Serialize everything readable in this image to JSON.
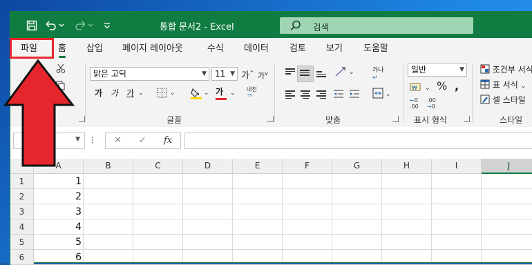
{
  "window": {
    "title": "통합 문서2  -  Excel",
    "search_placeholder": "검색",
    "quick_access": [
      "save-icon",
      "undo-icon",
      "redo-icon",
      "customize-icon"
    ]
  },
  "tabs": [
    "파일",
    "홈",
    "삽입",
    "페이지 레이아웃",
    "수식",
    "데이터",
    "검토",
    "보기",
    "도움말"
  ],
  "active_tab": "홈",
  "highlighted_tab": "파일",
  "ribbon": {
    "font": {
      "name": "맑은 고딕",
      "size": "11",
      "grow_label": "가",
      "shrink_label": "가",
      "bold": "가",
      "italic": "가",
      "underline": "가",
      "fill_color_label": "",
      "font_color_label": "가",
      "phonetic_label": "내천",
      "group_label": "글꼴"
    },
    "alignment": {
      "wrap_label": "가나",
      "group_label": "맞춤"
    },
    "number": {
      "format": "일반",
      "percent": "%",
      "group_label": "표시 형식"
    },
    "styles": {
      "items": [
        "조건부 서식",
        "표 서식",
        "셀 스타일"
      ],
      "group_label": "스타일"
    },
    "accent_color": "#107c41",
    "fill_underline_color": "#ffd400",
    "font_underline_color": "#e5262c"
  },
  "formula_bar": {
    "name_box": "",
    "cancel": "✕",
    "enter": "✓",
    "fx": "fx",
    "value": ""
  },
  "grid": {
    "columns": [
      "A",
      "B",
      "C",
      "D",
      "E",
      "F",
      "G",
      "H",
      "I",
      "J"
    ],
    "selected_column": "J",
    "rows": [
      "1",
      "2",
      "3",
      "4",
      "5",
      "6"
    ],
    "column_a_values": [
      "1",
      "2",
      "3",
      "4",
      "5",
      "6"
    ]
  },
  "annotation": {
    "arrow_color": "#e5262c"
  }
}
